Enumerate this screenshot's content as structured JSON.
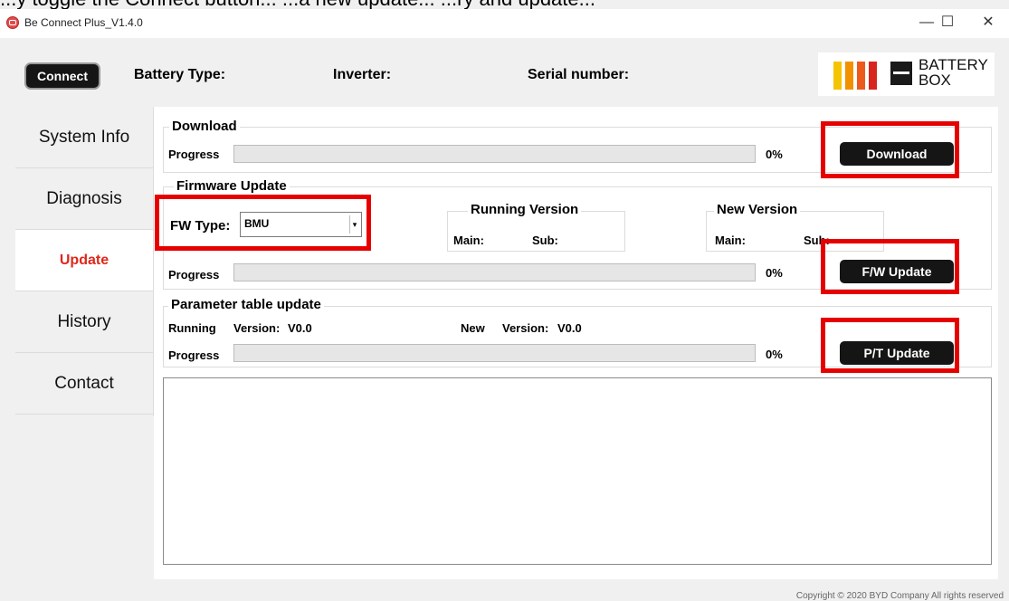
{
  "cutoff_text": "...y toggle the Connect button... ...a new update... ...ry and update...",
  "window": {
    "title": "Be Connect Plus_V1.4.0",
    "minimize": "—",
    "maximize": "☐",
    "close": "✕"
  },
  "header": {
    "connect_label": "Connect",
    "battery_type_label": "Battery Type:",
    "inverter_label": "Inverter:",
    "serial_label": "Serial number:",
    "logo_text_line1": "BATTERY",
    "logo_text_line2": "BOX",
    "logo_colors": [
      "#f5c400",
      "#f29100",
      "#ea5b1c",
      "#d7261e"
    ]
  },
  "sidebar": {
    "items": [
      {
        "label": "System Info",
        "active": false
      },
      {
        "label": "Diagnosis",
        "active": false
      },
      {
        "label": "Update",
        "active": true
      },
      {
        "label": "History",
        "active": false
      },
      {
        "label": "Contact",
        "active": false
      }
    ]
  },
  "download": {
    "title": "Download",
    "progress_label": "Progress",
    "progress_pct": "0%",
    "progress_value": 0,
    "button_label": "Download"
  },
  "firmware": {
    "title": "Firmware Update",
    "fw_type_label": "FW Type:",
    "fw_type_value": "BMU",
    "dropdown_arrow": "▾",
    "running_version_title": "Running Version",
    "running_main_label": "Main:",
    "running_sub_label": "Sub:",
    "new_version_title": "New Version",
    "new_main_label": "Main:",
    "new_sub_label": "Sub:",
    "progress_label": "Progress",
    "progress_pct": "0%",
    "progress_value": 0,
    "button_label": "F/W Update"
  },
  "parameter": {
    "title": "Parameter table update",
    "running_label": "Running",
    "running_version_label": "Version:",
    "running_version_value": "V0.0",
    "new_label": "New",
    "new_version_label": "Version:",
    "new_version_value": "V0.0",
    "progress_label": "Progress",
    "progress_pct": "0%",
    "progress_value": 0,
    "button_label": "P/T Update"
  },
  "log": {
    "text": ""
  },
  "footer": {
    "copyright": "Copyright © 2020 BYD Company All rights reserved"
  },
  "colors": {
    "accent_red": "#e0261a",
    "highlight_red": "#e60000",
    "button_black": "#151515"
  }
}
